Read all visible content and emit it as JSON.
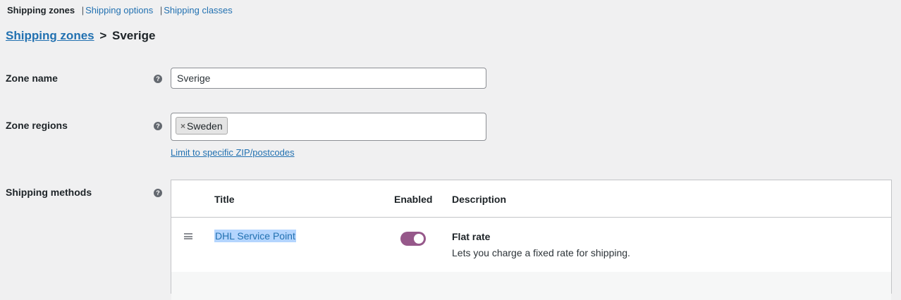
{
  "tabs": {
    "shipping_zones": "Shipping zones",
    "separator": "|",
    "shipping_options": "Shipping options",
    "shipping_classes": "Shipping classes"
  },
  "breadcrumb": {
    "parent": "Shipping zones",
    "separator": ">",
    "current": "Sverige"
  },
  "form": {
    "zone_name": {
      "label": "Zone name",
      "value": "Sverige",
      "help_icon": "question-circle-icon"
    },
    "zone_regions": {
      "label": "Zone regions",
      "selected": [
        "Sweden"
      ],
      "chip_remove": "×",
      "limit_link": "Limit to specific ZIP/postcodes",
      "help_icon": "question-circle-icon"
    },
    "shipping_methods": {
      "label": "Shipping methods",
      "help_icon": "question-circle-icon"
    }
  },
  "methods_table": {
    "columns": {
      "title": "Title",
      "enabled": "Enabled",
      "description": "Description"
    },
    "rows": [
      {
        "title": "DHL Service Point",
        "enabled": true,
        "method": "Flat rate",
        "description": "Lets you charge a fixed rate for shipping."
      }
    ]
  },
  "colors": {
    "link": "#2271b1",
    "toggle_on": "#96588a",
    "selection_highlight": "#b4d5fe",
    "background": "#f0f0f1"
  },
  "help_glyph": "?"
}
